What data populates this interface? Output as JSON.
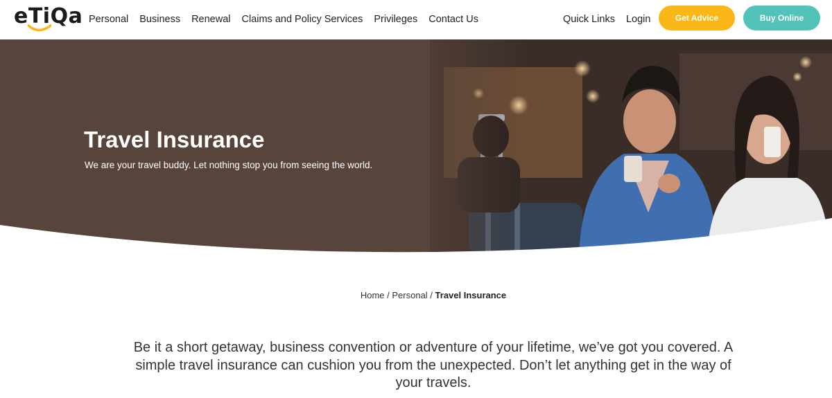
{
  "brand": {
    "logo_text": "eTiQa",
    "accent": "#fbb718"
  },
  "nav": {
    "items": [
      {
        "label": "Personal"
      },
      {
        "label": "Business"
      },
      {
        "label": "Renewal"
      },
      {
        "label": "Claims and Policy Services"
      },
      {
        "label": "Privileges"
      },
      {
        "label": "Contact Us"
      }
    ]
  },
  "right_links": {
    "quick_links": "Quick Links",
    "login": "Login"
  },
  "buttons": {
    "get_advice": {
      "label": "Get Advice",
      "color": "#fbb718"
    },
    "buy_online": {
      "label": "Buy Online",
      "color": "#53c2b8"
    }
  },
  "hero": {
    "title": "Travel Insurance",
    "subtitle": "We are your travel buddy. Let nothing stop you from seeing the world.",
    "panel_color": "#57443b"
  },
  "breadcrumb": {
    "home": "Home",
    "separator": " / ",
    "personal": "Personal",
    "current": "Travel Insurance"
  },
  "intro": {
    "text": "Be it a short getaway, business convention or adventure of your lifetime, we’ve got you covered. A simple travel insurance can cushion you from the unexpected. Don’t let anything get in the way of your travels."
  }
}
